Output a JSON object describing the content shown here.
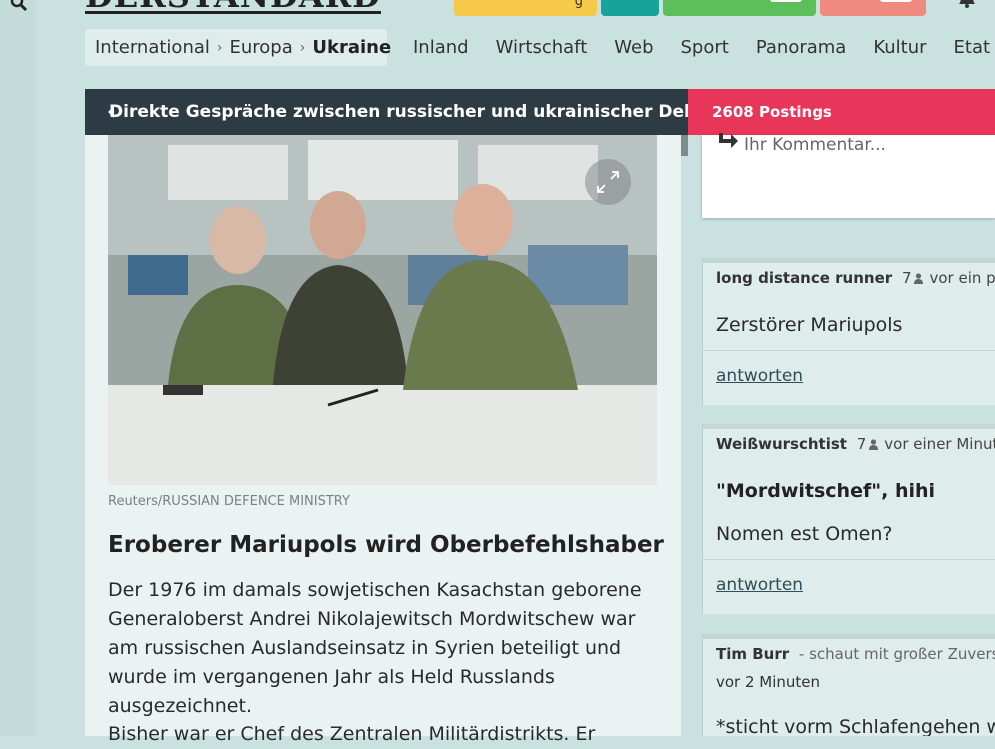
{
  "header": {
    "logo_text": "DERSTANDARD",
    "top_button_label": "g"
  },
  "breadcrumb": {
    "items": [
      "International",
      "Europa",
      "Ukraine"
    ],
    "separator": "›"
  },
  "nav": {
    "items": [
      "Inland",
      "Wirtschaft",
      "Web",
      "Sport",
      "Panorama",
      "Kultur",
      "Etat"
    ]
  },
  "article_bar": {
    "title": "Direkte Gespräche zwischen russischer und ukrainischer Del..."
  },
  "postings": {
    "label": "2608 Postings"
  },
  "comment_box": {
    "placeholder": "Ihr Kommentar..."
  },
  "article": {
    "caption": "Reuters/RUSSIAN DEFENCE MINISTRY",
    "headline": "Eroberer Mariupols wird Oberbefehlshaber",
    "paragraph1": "Der 1976 im damals sowjetischen Kasachstan geborene Generaloberst Andrei Nikolajewitsch Mordwitschew war am russischen Auslandseinsatz in Syrien beteiligt und wurde im vergangenen Jahr als Held Russlands ausgezeichnet.",
    "paragraph2": "Bisher war er Chef des Zentralen Militärdistrikts. Er"
  },
  "posts": [
    {
      "author": "long distance runner",
      "count": "7",
      "time": "vor ein paar",
      "text": "Zerstörer Mariupols",
      "reply": "antworten"
    },
    {
      "author": "Weißwurschtist",
      "count": "7",
      "time": "vor einer Minute",
      "title": "\"Mordwitschef\", hihi",
      "text": "Nomen est Omen?",
      "reply": "antworten"
    },
    {
      "author": "Tim Burr",
      "tagline": "- schaut mit großer Zuversic",
      "time": "vor 2 Minuten",
      "text": "*sticht vorm Schlafengehen we"
    }
  ],
  "colors": {
    "page_bg": "#c9e2e0",
    "article_bar": "#2d3c44",
    "postings_bar": "#e7365a",
    "btn_yellow": "#f6c94a",
    "btn_teal": "#18a39a",
    "btn_green": "#5cbf5a",
    "btn_salmon": "#ef8a7e"
  }
}
